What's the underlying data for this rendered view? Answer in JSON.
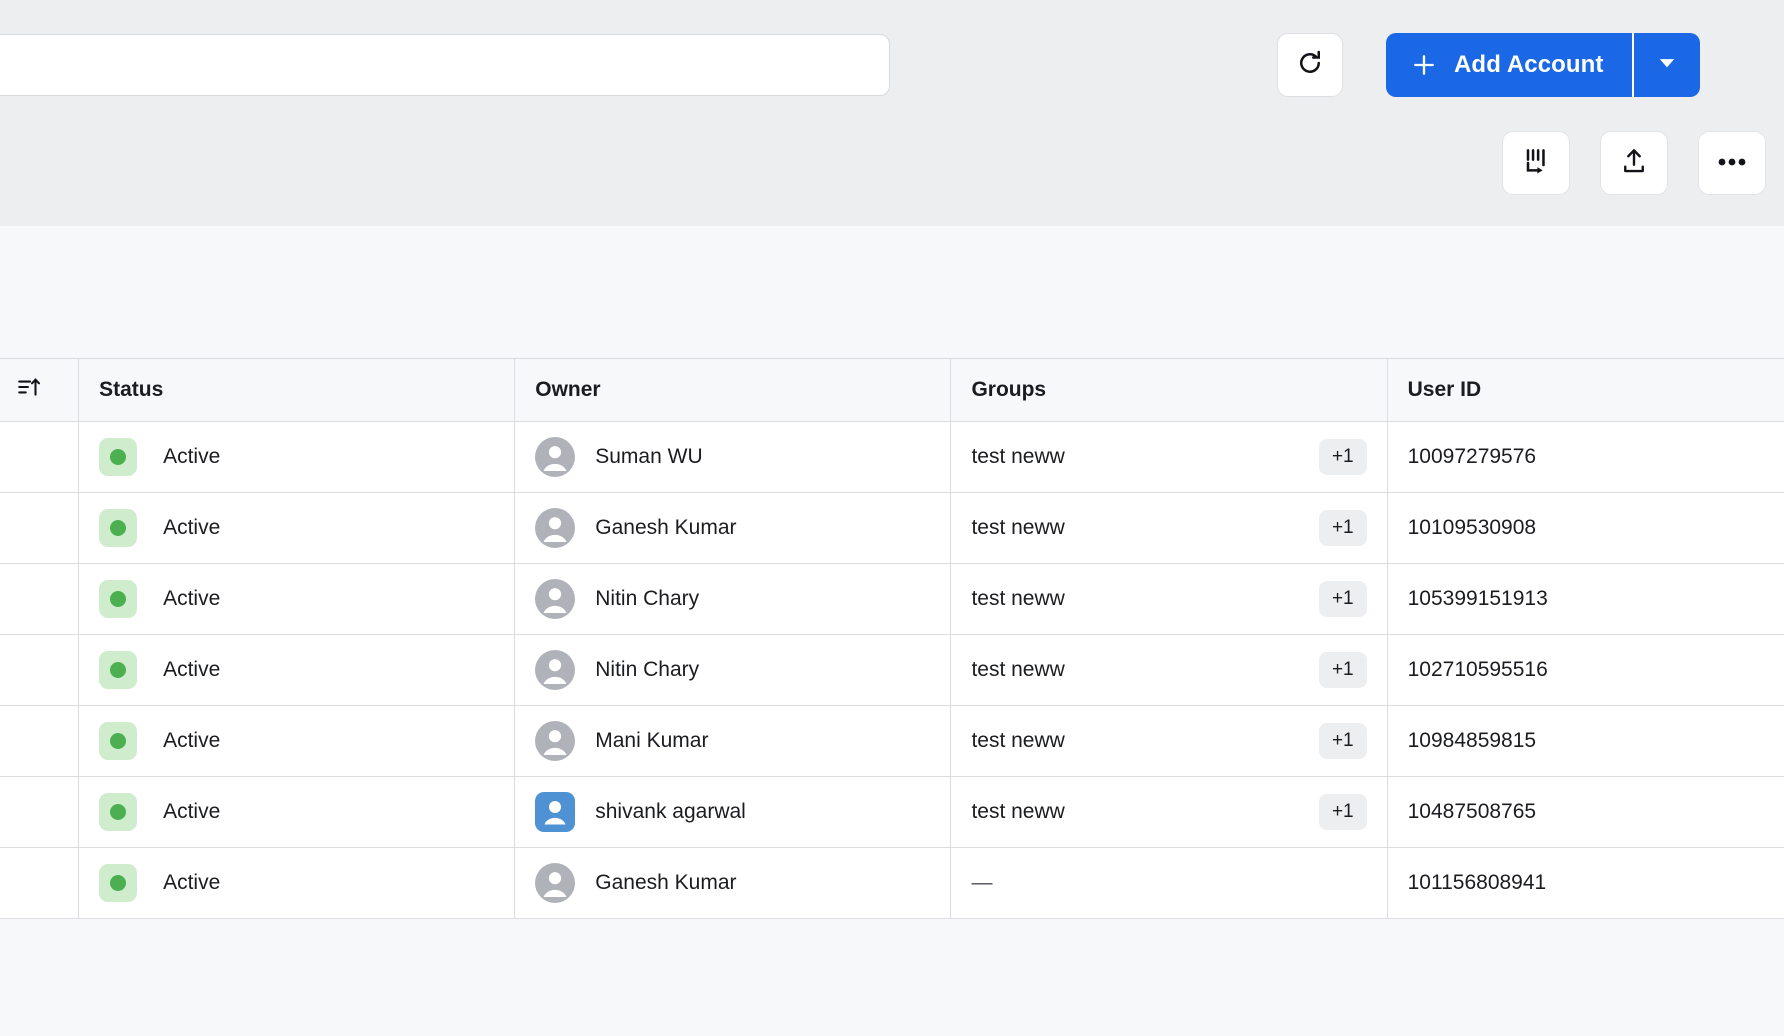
{
  "toolbar": {
    "search_value": "",
    "search_placeholder": "",
    "refresh_icon": "refresh-icon",
    "add_account_label": "Add Account",
    "add_plus_icon": "plus-icon",
    "add_caret_icon": "chevron-down-icon",
    "accent_color": "#1a68e5"
  },
  "icon_actions": [
    {
      "name": "columns-icon",
      "title": "Columns"
    },
    {
      "name": "upload-icon",
      "title": "Export"
    },
    {
      "name": "more-options-icon",
      "title": "More"
    }
  ],
  "table": {
    "sort_icon": "sort-ascending-icon",
    "columns": [
      "Status",
      "Owner",
      "Groups",
      "User ID"
    ],
    "rows": [
      {
        "status": "Active",
        "owner": "Suman WU",
        "avatar": "gray-circle",
        "group": "test neww",
        "extra": "+1",
        "user_id": "10097279576"
      },
      {
        "status": "Active",
        "owner": "Ganesh Kumar",
        "avatar": "gray-circle",
        "group": "test neww",
        "extra": "+1",
        "user_id": "10109530908"
      },
      {
        "status": "Active",
        "owner": "Nitin Chary",
        "avatar": "gray-circle",
        "group": "test neww",
        "extra": "+1",
        "user_id": "105399151913"
      },
      {
        "status": "Active",
        "owner": "Nitin Chary",
        "avatar": "gray-circle",
        "group": "test neww",
        "extra": "+1",
        "user_id": "102710595516"
      },
      {
        "status": "Active",
        "owner": "Mani Kumar",
        "avatar": "gray-circle",
        "group": "test neww",
        "extra": "+1",
        "user_id": "10984859815"
      },
      {
        "status": "Active",
        "owner": "shivank agarwal",
        "avatar": "blue-square",
        "group": "test neww",
        "extra": "+1",
        "user_id": "10487508765"
      },
      {
        "status": "Active",
        "owner": "Ganesh Kumar",
        "avatar": "gray-circle",
        "group": "—",
        "extra": "",
        "user_id": "101156808941"
      }
    ]
  },
  "colors": {
    "status_dot": "#4caf50",
    "status_badge_bg": "#cfeccd",
    "avatar_gray": "#b0b2ba",
    "avatar_blue": "#4f92d4",
    "chip_bg": "#eceef0"
  }
}
